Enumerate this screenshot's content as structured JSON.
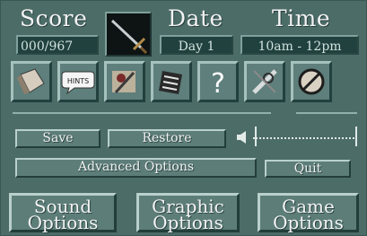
{
  "header": {
    "score_label": "Score",
    "score_value": "000/967",
    "date_label": "Date",
    "date_value": "Day 1",
    "time_label": "Time",
    "time_value": "10am - 12pm"
  },
  "toolbar_icons": [
    {
      "name": "inventory-bag-icon"
    },
    {
      "name": "hints-icon",
      "text": "HINTS"
    },
    {
      "name": "walk-map-icon"
    },
    {
      "name": "notebook-icon"
    },
    {
      "name": "help-question-icon",
      "text": "?"
    },
    {
      "name": "tool-combine-icon"
    },
    {
      "name": "no-symbol-icon"
    }
  ],
  "buttons": {
    "save": "Save",
    "restore": "Restore",
    "advanced": "Advanced Options",
    "quit": "Quit"
  },
  "bottom": {
    "sound": [
      "Sound",
      "Options"
    ],
    "graphic": [
      "Graphic",
      "Options"
    ],
    "game": [
      "Game",
      "Options"
    ]
  },
  "volume_icon": "speaker-icon",
  "colors": {
    "panel": "#4c6c68",
    "field": "#21413e",
    "button": "#5d7d79"
  }
}
